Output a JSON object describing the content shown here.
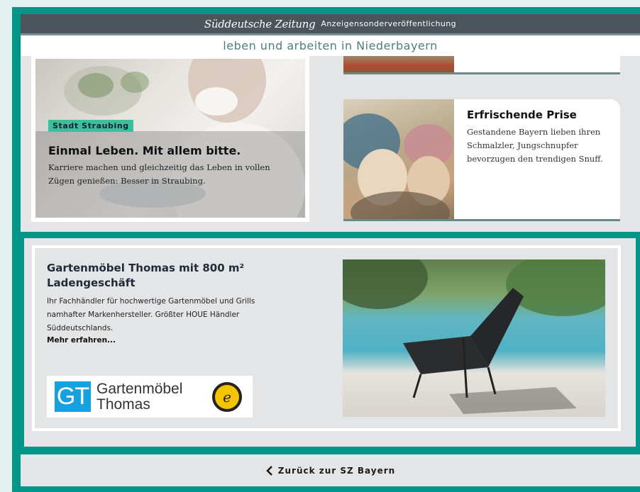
{
  "header": {
    "logo": "Süddeutsche Zeitung",
    "subtitle": "Anzeigensonderveröffentlichung",
    "page_title": "leben und arbeiten in Niederbayern"
  },
  "cards": {
    "left": {
      "tag": "Stadt Straubing",
      "title": "Einmal Leben. Mit allem bitte.",
      "text": "Karriere machen und gleichzeitig das Leben in vollen Zügen genießen: Besser in Straubing."
    },
    "right": {
      "title": "Erfrischende Prise",
      "text": "Gestandene Bayern lieben ihren Schmalzler, Jungschnupfer bevorzugen den trendigen Snuff."
    }
  },
  "ad": {
    "title": "Gartenmöbel Thomas mit 800 m² Ladengeschäft",
    "text": "Ihr Fachhändler für hochwertige Gartenmöbel und Grills namhafter Markenhersteller. Größter HOUE Händler Süddeutschlands.",
    "more_label": "Mehr erfahren...",
    "logo_mark": "GT",
    "logo_name_line1": "Gartenmöbel",
    "logo_name_line2": "Thomas",
    "badge_letter": "e"
  },
  "footer": {
    "back_label": "Zurück zur SZ Bayern"
  },
  "colors": {
    "teal_frame": "#009688",
    "header_bar": "#4a545a",
    "title_text": "#4e7f7f",
    "tag_bg": "#3cbf9c",
    "gt_blue": "#17a1df",
    "badge_yellow": "#f4c400"
  },
  "icons": {
    "back": "chevron-left-icon",
    "trust": "trusted-shops-badge-icon"
  }
}
